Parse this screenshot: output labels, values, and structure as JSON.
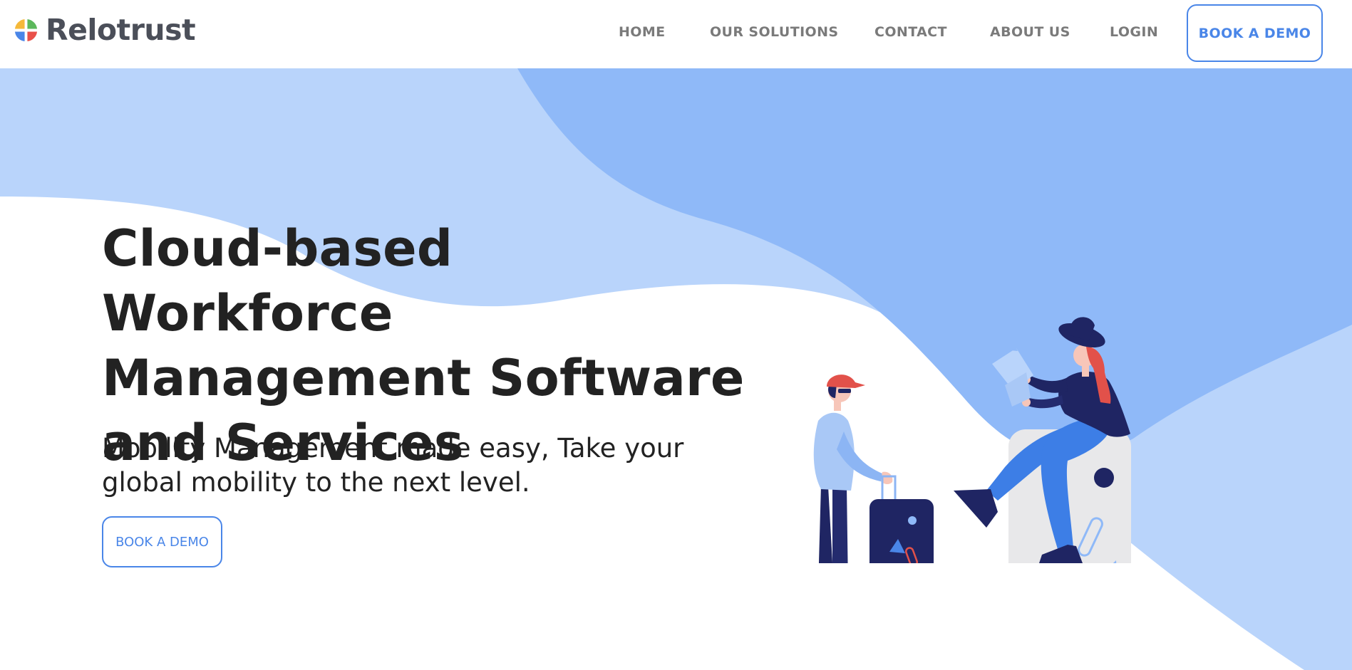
{
  "colors": {
    "accent": "#4a86e8",
    "hero_light_blue": "#b9d4fb",
    "hero_mid_blue": "#8fb9f8",
    "heading_text": "#222222",
    "nav_text": "#7a7a7a",
    "navy": "#1f2563"
  },
  "header": {
    "logo_text": "Relotrust",
    "logo_icon": "four-color-quadrant-logo-icon",
    "nav": [
      {
        "label": "HOME"
      },
      {
        "label": "OUR SOLUTIONS"
      },
      {
        "label": "CONTACT"
      },
      {
        "label": "ABOUT US"
      },
      {
        "label": "LOGIN"
      }
    ],
    "cta_label": "BOOK A DEMO"
  },
  "hero": {
    "title_lines": [
      "Cloud-based Workforce",
      "Management Software",
      "and Services"
    ],
    "subtitle_lines": [
      "Mobility Management made easy, Take your",
      "global mobility to the next level."
    ],
    "cta_label": "BOOK A DEMO",
    "illustration_icon": "travelers-with-suitcases-illustration"
  }
}
